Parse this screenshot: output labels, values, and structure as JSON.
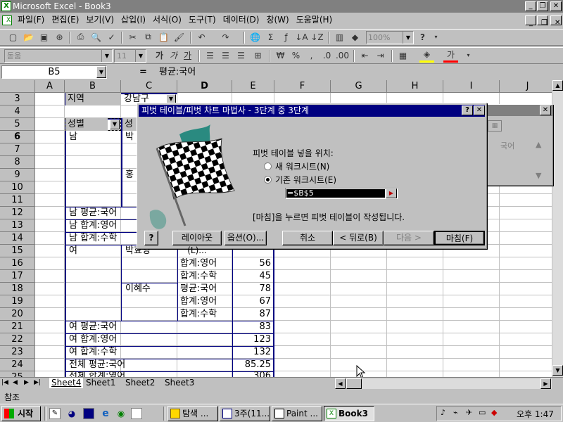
{
  "app": {
    "title": "Microsoft Excel - Book3"
  },
  "menu": [
    "파일(F)",
    "편집(E)",
    "보기(V)",
    "삽입(I)",
    "서식(O)",
    "도구(T)",
    "데이터(D)",
    "창(W)",
    "도움말(H)"
  ],
  "toolbar": {
    "zoom": "100%",
    "font_name": "돋움",
    "font_size": "11"
  },
  "formula_bar": {
    "name_box": "B5",
    "equals": "=",
    "content": "평균:국어"
  },
  "columns": [
    "A",
    "B",
    "C",
    "D",
    "E",
    "F",
    "G",
    "H",
    "I",
    "J"
  ],
  "rows": [
    "3",
    "4",
    "5",
    "6",
    "7",
    "8",
    "9",
    "10",
    "11",
    "12",
    "13",
    "14",
    "15",
    "16",
    "17",
    "18",
    "19",
    "20",
    "21",
    "22",
    "23",
    "24",
    "25"
  ],
  "cells": {
    "b3": "지역",
    "c3": "강남구",
    "b5": "성별",
    "c5": "성",
    "b6": "남",
    "c6": "박",
    "c9": "홍",
    "b12": "남 평균:국어",
    "b13": "남 합계:영어",
    "b14": "남 합계:수학",
    "b15": "여",
    "c15": "박효영",
    "d16": "합계:영어",
    "e16": "56",
    "d17": "합계:수학",
    "e17": "45",
    "c18": "이혜수",
    "d18": "평균:국어",
    "e18": "78",
    "d19": "합계:영어",
    "e19": "67",
    "d20": "합계:수학",
    "e20": "87",
    "b21": "여 평균:국어",
    "e21": "83",
    "b22": "여 합계:영어",
    "e22": "123",
    "b23": "여 합계:수학",
    "e23": "132",
    "b24": "전체 평균:국어",
    "e24": "85.25",
    "b25": "전체 합계:영어",
    "e25": "306"
  },
  "sheet_tabs": [
    "Sheet4",
    "Sheet1",
    "Sheet2",
    "Sheet3"
  ],
  "status_bar": {
    "text": "참조"
  },
  "dialog": {
    "title": "피벗 테이블/피벗 차트 마법사 - 3단계 중 3단계",
    "question": "피벗 테이블 넣을 위치:",
    "option_new": "새 워크시트(N)",
    "option_existing": "기존 워크시트(E)",
    "location_value": "=$B$5",
    "hint": "[마침]을 누르면 피벗 테이블이 작성됩니다.",
    "buttons": {
      "help": "?",
      "layout": "레이아웃(L)...",
      "options": "옵션(O)...",
      "cancel": "취소",
      "back": "< 뒤로(B)",
      "next": "다음 >",
      "finish": "마침(F)"
    }
  },
  "pivot_toolbar": {
    "item": "국어"
  },
  "taskbar": {
    "start": "시작",
    "tasks": [
      "탐색 ...",
      "3주(11...",
      "Paint ...",
      "Book3"
    ],
    "clock": "오후 1:47"
  },
  "colors": {
    "title_active": "#000080",
    "title_inactive": "#808080",
    "desktop": "#008080"
  }
}
